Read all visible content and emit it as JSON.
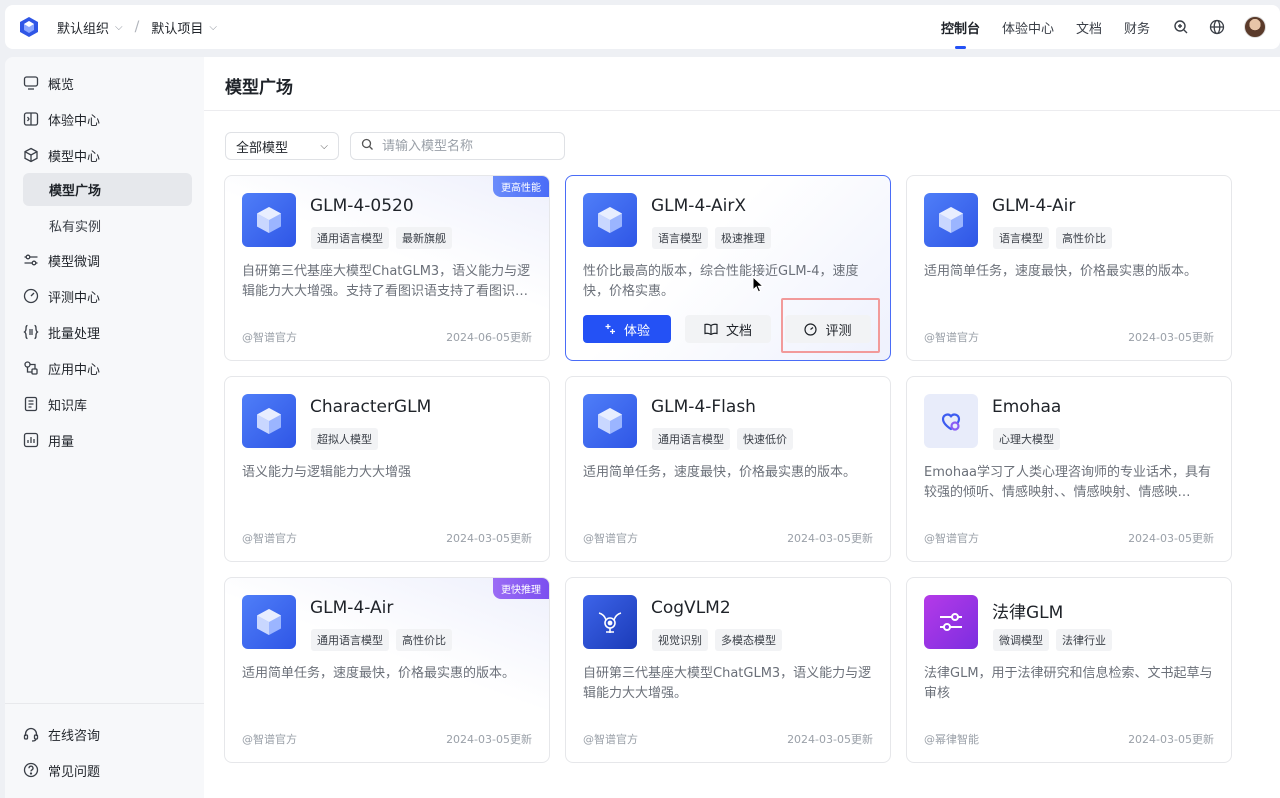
{
  "header": {
    "org": "默认组织",
    "project": "默认项目",
    "crumb_separator": "/",
    "nav": [
      {
        "label": "控制台",
        "active": true
      },
      {
        "label": "体验中心",
        "active": false
      },
      {
        "label": "文档",
        "active": false
      },
      {
        "label": "财务",
        "active": false
      }
    ],
    "icons": [
      "support-icon",
      "globe-icon",
      "avatar"
    ]
  },
  "sidebar": {
    "items": [
      {
        "label": "概览",
        "icon": "monitor-icon"
      },
      {
        "label": "体验中心",
        "icon": "experience-icon"
      },
      {
        "label": "模型中心",
        "icon": "cube-icon"
      },
      {
        "label": "模型广场",
        "sub": true,
        "active": true
      },
      {
        "label": "私有实例",
        "sub": true
      },
      {
        "label": "模型微调",
        "icon": "sliders-icon"
      },
      {
        "label": "评测中心",
        "icon": "gauge-icon"
      },
      {
        "label": "批量处理",
        "icon": "braces-icon"
      },
      {
        "label": "应用中心",
        "icon": "apps-icon"
      },
      {
        "label": "知识库",
        "icon": "book-icon"
      },
      {
        "label": "用量",
        "icon": "chart-icon"
      }
    ],
    "bottom": [
      {
        "label": "在线咨询",
        "icon": "headset-icon"
      },
      {
        "label": "常见问题",
        "icon": "help-icon"
      }
    ]
  },
  "main": {
    "title": "模型广场",
    "filter": {
      "value": "全部模型"
    },
    "search": {
      "placeholder": "请输入模型名称"
    },
    "cards": [
      {
        "name": "GLM-4-0520",
        "tags": [
          "通用语言模型",
          "最新旗舰"
        ],
        "desc": "自研第三代基座大模型ChatGLM3，语义能力与逻辑能力大大增强。支持了看图识语支持了看图识语图...",
        "org": "@智谱官方",
        "date": "2024-06-05更新",
        "ribbon": "更高性能"
      },
      {
        "name": "GLM-4-AirX",
        "tags": [
          "语言模型",
          "极速推理"
        ],
        "desc": "性价比最高的版本，综合性能接近GLM-4，速度快，价格实惠。",
        "org": "",
        "date": "",
        "actions": [
          "体验",
          "文档",
          "评测"
        ]
      },
      {
        "name": "GLM-4-Air",
        "tags": [
          "语言模型",
          "高性价比"
        ],
        "desc": "适用简单任务，速度最快，价格最实惠的版本。",
        "org": "@智谱官方",
        "date": "2024-03-05更新"
      },
      {
        "name": "CharacterGLM",
        "tags": [
          "超拟人模型"
        ],
        "desc": "语义能力与逻辑能力大大增强",
        "org": "@智谱官方",
        "date": "2024-03-05更新"
      },
      {
        "name": "GLM-4-Flash",
        "tags": [
          "通用语言模型",
          "快速低价"
        ],
        "desc": "适用简单任务，速度最快，价格最实惠的版本。",
        "org": "@智谱官方",
        "date": "2024-03-05更新"
      },
      {
        "name": "Emohaa",
        "tags": [
          "心理大模型"
        ],
        "desc": "Emohaa学习了人类心理咨询师的专业话术，具有较强的倾听、情感映射、、情感映射、情感映射，、...",
        "org": "@智谱官方",
        "date": "2024-03-05更新"
      },
      {
        "name": "GLM-4-Air",
        "tags": [
          "通用语言模型",
          "高性价比"
        ],
        "desc": "适用简单任务，速度最快，价格最实惠的版本。",
        "org": "@智谱官方",
        "date": "2024-03-05更新",
        "ribbon": "更快推理"
      },
      {
        "name": "CogVLM2",
        "tags": [
          "视觉识别",
          "多模态模型"
        ],
        "desc": "自研第三代基座大模型ChatGLM3，语义能力与逻辑能力大大增强。",
        "org": "@智谱官方",
        "date": "2024-03-05更新"
      },
      {
        "name": "法律GLM",
        "tags": [
          "微调模型",
          "法律行业"
        ],
        "desc": "法律GLM，用于法律研究和信息检索、文书起草与审核",
        "org": "@幂律智能",
        "date": "2024-03-05更新"
      }
    ]
  },
  "colors": {
    "accent": "#2451f5",
    "highlight": "#f29a9a"
  }
}
